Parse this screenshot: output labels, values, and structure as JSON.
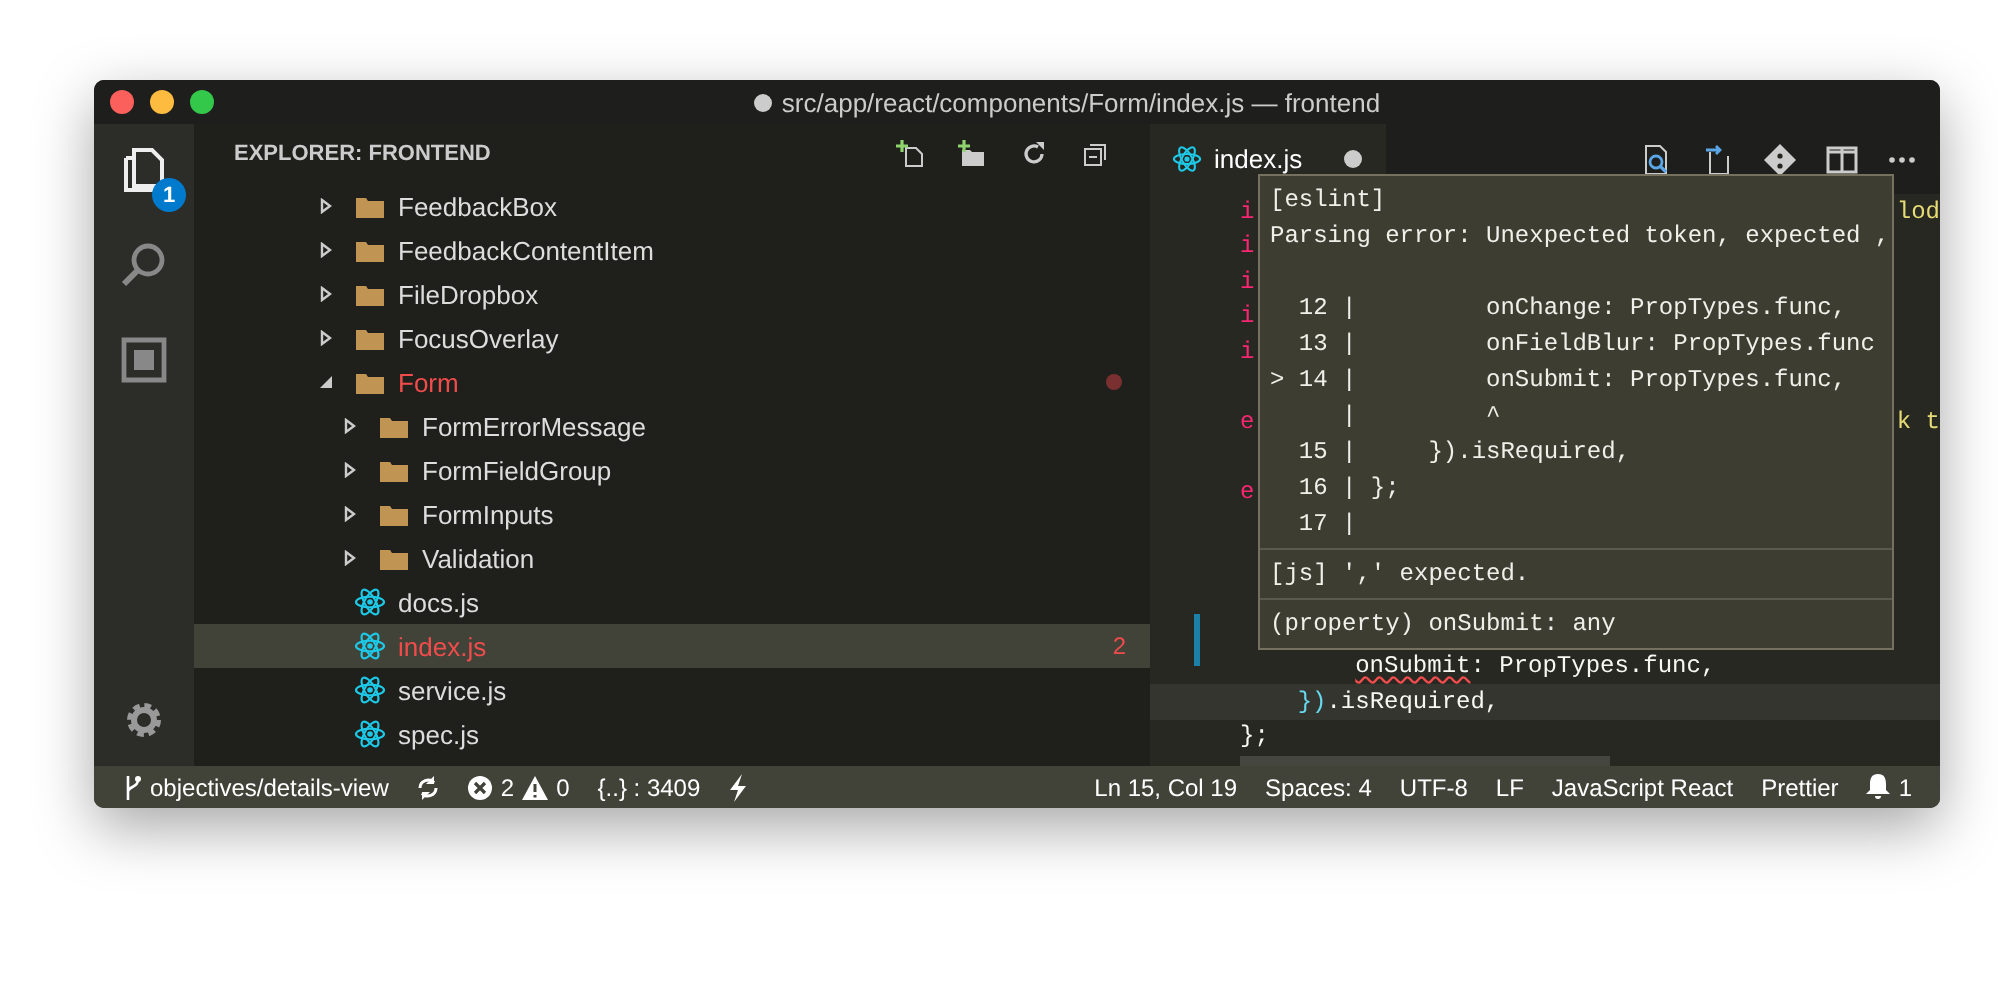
{
  "window": {
    "title": "src/app/react/components/Form/index.js — frontend",
    "dirty": true
  },
  "activity_bar": {
    "explorer_badge": "1"
  },
  "sidebar": {
    "title": "EXPLORER: FRONTEND",
    "tree": [
      {
        "label": "FeedbackBox",
        "kind": "folder",
        "expanded": false,
        "has_errors": false,
        "selected": false
      },
      {
        "label": "FeedbackContentItem",
        "kind": "folder",
        "expanded": false,
        "has_errors": false,
        "selected": false
      },
      {
        "label": "FileDropbox",
        "kind": "folder",
        "expanded": false,
        "has_errors": false,
        "selected": false
      },
      {
        "label": "FocusOverlay",
        "kind": "folder",
        "expanded": false,
        "has_errors": false,
        "selected": false
      },
      {
        "label": "Form",
        "kind": "folder",
        "expanded": true,
        "has_errors": true,
        "selected": false,
        "children": [
          {
            "label": "FormErrorMessage",
            "kind": "folder",
            "expanded": false,
            "has_errors": false,
            "selected": false
          },
          {
            "label": "FormFieldGroup",
            "kind": "folder",
            "expanded": false,
            "has_errors": false,
            "selected": false
          },
          {
            "label": "FormInputs",
            "kind": "folder",
            "expanded": false,
            "has_errors": false,
            "selected": false
          },
          {
            "label": "Validation",
            "kind": "folder",
            "expanded": false,
            "has_errors": false,
            "selected": false
          },
          {
            "label": "docs.js",
            "kind": "file",
            "has_errors": false,
            "selected": false
          },
          {
            "label": "index.js",
            "kind": "file",
            "has_errors": true,
            "selected": true,
            "badge": "2"
          },
          {
            "label": "service.js",
            "kind": "file",
            "has_errors": false,
            "selected": false
          },
          {
            "label": "spec.js",
            "kind": "file",
            "has_errors": false,
            "selected": false
          }
        ]
      }
    ]
  },
  "editor": {
    "tab": {
      "label": "index.js",
      "dirty": true
    },
    "lines": [
      {
        "kind": "code",
        "left": [
          {
            "text": "i",
            "kind": "keyword"
          }
        ],
        "right": [
          {
            "text": "lod",
            "kind": "string"
          }
        ]
      },
      {
        "kind": "code",
        "left": [
          {
            "text": "i",
            "kind": "keyword"
          }
        ]
      },
      {
        "kind": "code",
        "left": [
          {
            "text": "i",
            "kind": "keyword"
          }
        ]
      },
      {
        "kind": "code",
        "left": [
          {
            "text": "i",
            "kind": "keyword"
          }
        ]
      },
      {
        "kind": "code",
        "left": [
          {
            "text": "i",
            "kind": "keyword"
          }
        ]
      },
      {
        "kind": "blank"
      },
      {
        "kind": "code",
        "left": [
          {
            "text": "e",
            "kind": "keyword"
          }
        ],
        "right": [
          {
            "text": "k t",
            "kind": "string"
          }
        ]
      },
      {
        "kind": "blank"
      },
      {
        "kind": "code",
        "left": [
          {
            "text": "e",
            "kind": "keyword"
          }
        ]
      },
      {
        "kind": "blank"
      },
      {
        "kind": "blank"
      },
      {
        "kind": "blank"
      },
      {
        "kind": "blank",
        "modified": true
      },
      {
        "kind": "code",
        "left": [
          {
            "text": "        onSubmit",
            "kind": "plain",
            "error": true
          },
          {
            "text": ": PropTypes.func,",
            "kind": "plain"
          }
        ]
      },
      {
        "kind": "code",
        "current": true,
        "left": [
          {
            "text": "    })",
            "kind": "bracket"
          },
          {
            "text": ".isRequired,",
            "kind": "plain"
          }
        ]
      },
      {
        "kind": "code",
        "left": [
          {
            "text": "};",
            "kind": "plain"
          }
        ]
      }
    ],
    "hover": {
      "sections": [
        {
          "divider": false,
          "lines": [
            "[eslint]",
            "Parsing error: Unexpected token, expected ,"
          ]
        },
        {
          "divider": false,
          "lines": [
            "  12 |         onChange: PropTypes.func,",
            "  13 |         onFieldBlur: PropTypes.func",
            "> 14 |         onSubmit: PropTypes.func,",
            "     |         ^",
            "  15 |     }).isRequired,",
            "  16 | };",
            "  17 |"
          ]
        },
        {
          "divider": true,
          "lines": [
            "[js] ',' expected."
          ]
        },
        {
          "divider": true,
          "lines": [
            "(property) onSubmit: any"
          ]
        }
      ]
    }
  },
  "status_bar": {
    "branch": "objectives/details-view",
    "errors": "2",
    "warnings": "0",
    "symbols": "{..} : 3409",
    "right": [
      "Ln 15, Col 19",
      "Spaces: 4",
      "UTF-8",
      "LF",
      "JavaScript React",
      "Prettier"
    ],
    "notifications": "1"
  }
}
